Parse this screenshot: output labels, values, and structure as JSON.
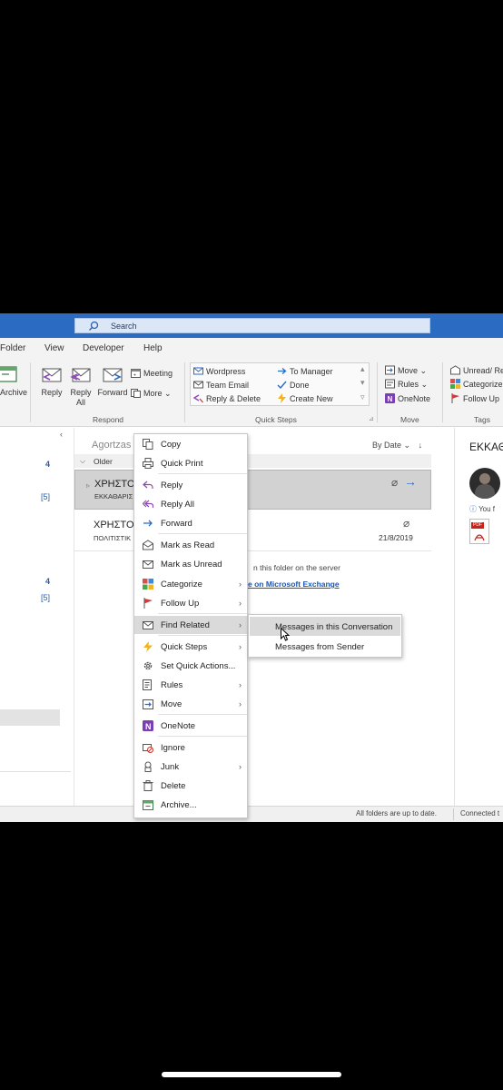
{
  "search": {
    "label": "Search"
  },
  "tabs": [
    "Folder",
    "View",
    "Developer",
    "Help"
  ],
  "ribbon": {
    "archive": "Archive",
    "reply": "Reply",
    "reply_all": "Reply All",
    "forward": "Forward",
    "meeting": "Meeting",
    "more": "More",
    "respond_label": "Respond",
    "quick_steps": [
      "Wordpress",
      "Team Email",
      "Reply & Delete",
      "To Manager",
      "Done",
      "Create New"
    ],
    "quick_steps_label": "Quick Steps",
    "move": "Move",
    "rules": "Rules",
    "onenote": "OneNote",
    "move_label": "Move",
    "unread": "Unread/ Re",
    "categorize": "Categorize",
    "follow_up": "Follow Up",
    "tags_label": "Tags"
  },
  "folder_counts": [
    "4",
    "[5]",
    "4",
    "[5]"
  ],
  "message_list": {
    "search_name": "Agortzas",
    "sort": "By Date",
    "group_header": "Older",
    "messages": [
      {
        "from": "ΧΡΗΣΤΟ",
        "subject": "ΕΚΚΑΘΑΡΙΣ"
      },
      {
        "from": "ΧΡΗΣΤΟ",
        "subject": "ΠΟΛΙΤΙΣΤΙΚ",
        "date": "21/8/2019"
      }
    ],
    "server_note": "n this folder on the server",
    "exchange_link": "e on Microsoft Exchange"
  },
  "reading": {
    "title": "ΕΚΚΑΘ",
    "you_forwarded": "You f",
    "attachment_badge": "PDF"
  },
  "context_menu": {
    "items": [
      {
        "label": "Copy",
        "submenu": false
      },
      {
        "label": "Quick Print",
        "submenu": false
      },
      {
        "label": "Reply",
        "submenu": false
      },
      {
        "label": "Reply All",
        "submenu": false
      },
      {
        "label": "Forward",
        "submenu": false
      },
      {
        "label": "Mark as Read",
        "submenu": false
      },
      {
        "label": "Mark as Unread",
        "submenu": false
      },
      {
        "label": "Categorize",
        "submenu": true
      },
      {
        "label": "Follow Up",
        "submenu": true
      },
      {
        "label": "Find Related",
        "submenu": true
      },
      {
        "label": "Quick Steps",
        "submenu": true
      },
      {
        "label": "Set Quick Actions...",
        "submenu": false
      },
      {
        "label": "Rules",
        "submenu": true
      },
      {
        "label": "Move",
        "submenu": true
      },
      {
        "label": "OneNote",
        "submenu": false
      },
      {
        "label": "Ignore",
        "submenu": false
      },
      {
        "label": "Junk",
        "submenu": true
      },
      {
        "label": "Delete",
        "submenu": false
      },
      {
        "label": "Archive...",
        "submenu": false
      }
    ],
    "submenu_items": [
      "Messages in this Conversation",
      "Messages from Sender"
    ]
  },
  "status": {
    "sync": "All folders are up to date.",
    "connection": "Connected t"
  },
  "colors": {
    "titlebar": "#2b6bc1",
    "accent": "#2a5da8"
  }
}
